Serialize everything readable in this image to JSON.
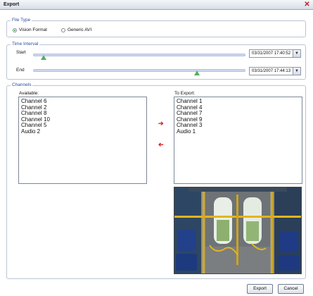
{
  "window": {
    "title": "Export"
  },
  "file_type": {
    "legend": "File Type",
    "options": [
      {
        "label": "Vision Format",
        "selected": true
      },
      {
        "label": "Generic AVI",
        "selected": false
      }
    ]
  },
  "time_interval": {
    "legend": "Time Interval",
    "start": {
      "label": "Start",
      "value": "03/31/2007 17:40:52",
      "slider_fraction": 0.05
    },
    "end": {
      "label": "End",
      "value": "03/31/2007 17:44:13",
      "slider_fraction": 0.77
    }
  },
  "channels": {
    "legend": "Channels",
    "available_title": "Available:",
    "available": [
      "Channel 6",
      "Channel 2",
      "Channel 8",
      "Channel 10",
      "Channel 5",
      "Audio 2"
    ],
    "to_export_title": "To Export:",
    "to_export": [
      "Channel 1",
      "Channel 4",
      "Channel 7",
      "Channel 9",
      "Channel 3",
      "Audio 1"
    ]
  },
  "buttons": {
    "export": "Export",
    "cancel": "Cancel"
  },
  "colors": {
    "accent": "#2b4f99",
    "slider_thumb": "#57b05a",
    "arrow": "#e02020"
  }
}
